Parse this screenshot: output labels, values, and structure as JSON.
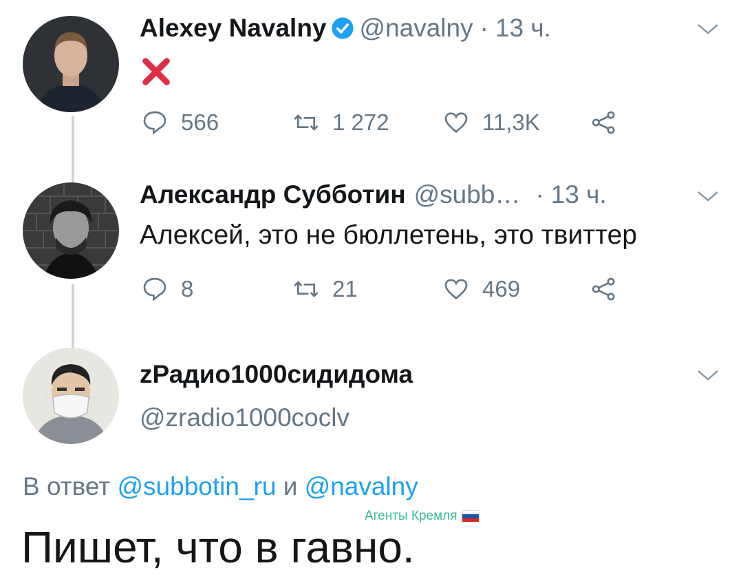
{
  "tweets": [
    {
      "name": "Alexey Navalny",
      "handle": "@navalny",
      "separator": "·",
      "time": "13 ч.",
      "content_icon": "red-cross-mark-icon",
      "replies": "566",
      "retweets": "1 272",
      "likes": "11,3K"
    },
    {
      "name": "Александр Субботин",
      "handle": "@subb…",
      "separator": "·",
      "time": "13 ч.",
      "text": "Алексей, это не бюллетень, это твиттер",
      "replies": "8",
      "retweets": "21",
      "likes": "469"
    }
  ],
  "focused": {
    "name": "zРадио1000сидидома",
    "handle": "@zradio1000coclv",
    "reply_prefix": "В ответ",
    "reply_user1": "@subbotin_ru",
    "reply_conj": "и",
    "reply_user2": "@navalny",
    "text": "Пишет, что в гавно."
  },
  "watermark": {
    "text": "Агенты Кремля",
    "icon": "russian-flag-icon"
  },
  "colors": {
    "link": "#1da1f2",
    "secondary": "#657786",
    "verified": "#1da1f2",
    "cross": "#dd2e44",
    "watermark": "#3cba9f"
  }
}
